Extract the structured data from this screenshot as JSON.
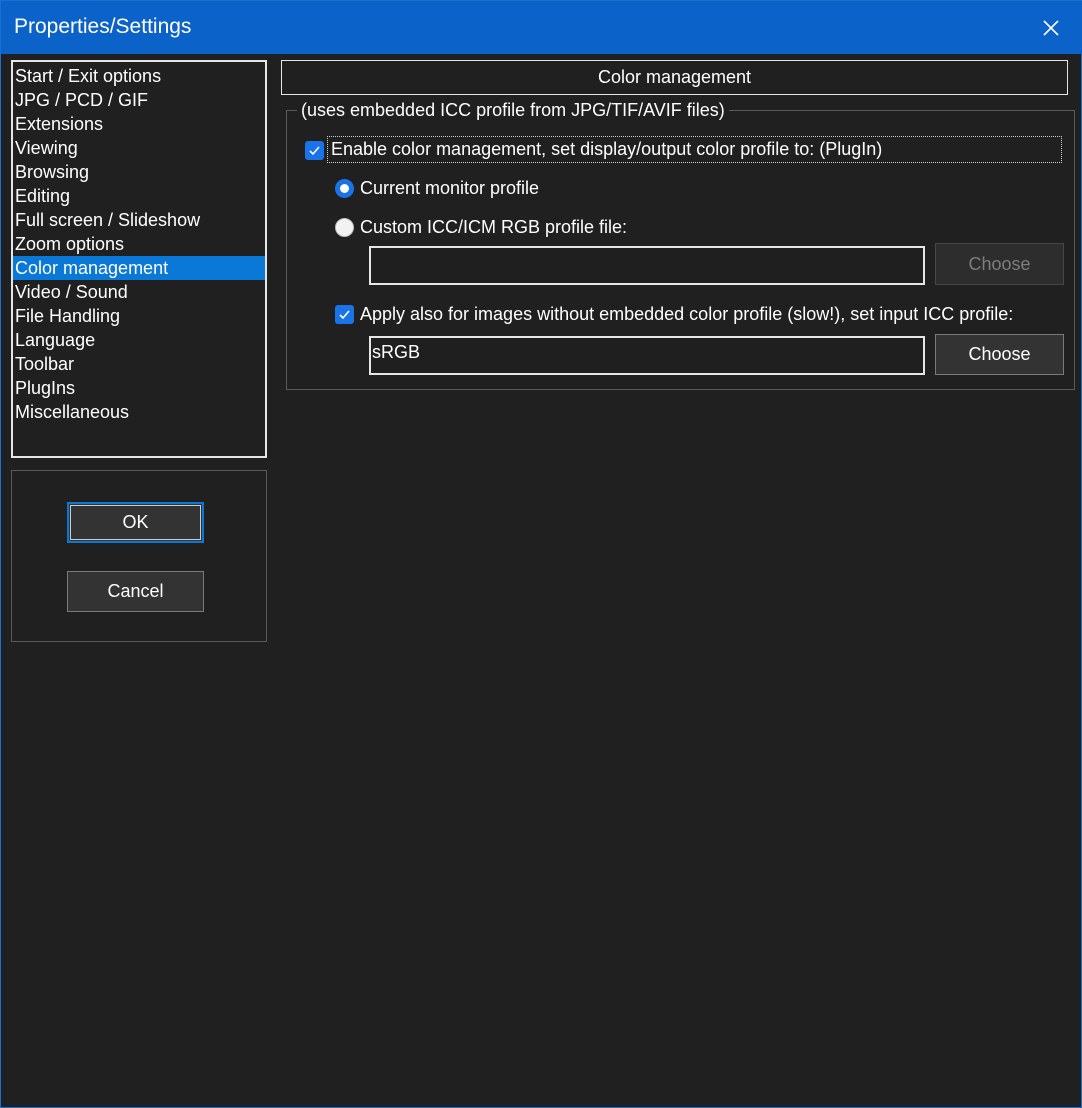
{
  "window": {
    "title": "Properties/Settings"
  },
  "sidebar": {
    "items": [
      {
        "label": "Start / Exit options"
      },
      {
        "label": "JPG / PCD / GIF"
      },
      {
        "label": "Extensions"
      },
      {
        "label": "Viewing"
      },
      {
        "label": "Browsing"
      },
      {
        "label": "Editing"
      },
      {
        "label": "Full screen / Slideshow"
      },
      {
        "label": "Zoom options"
      },
      {
        "label": "Color management",
        "selected": true
      },
      {
        "label": "Video / Sound"
      },
      {
        "label": "File Handling"
      },
      {
        "label": "Language"
      },
      {
        "label": "Toolbar"
      },
      {
        "label": "PlugIns"
      },
      {
        "label": "Miscellaneous"
      }
    ]
  },
  "buttons": {
    "ok": "OK",
    "cancel": "Cancel"
  },
  "panel": {
    "header": "Color management",
    "group_legend": "(uses embedded ICC profile from JPG/TIF/AVIF files)",
    "enable_cm": {
      "label": "Enable color management, set display/output color profile to: (PlugIn)",
      "checked": true
    },
    "radio_current": {
      "label": "Current monitor profile",
      "selected": true
    },
    "radio_custom": {
      "label": "Custom ICC/ICM RGB profile file:",
      "selected": false
    },
    "custom_profile_path": "",
    "choose_custom": "Choose",
    "apply_also": {
      "label": "Apply also for images without embedded color profile (slow!), set input ICC profile:",
      "checked": true
    },
    "input_profile": "sRGB",
    "choose_input": "Choose"
  },
  "colors": {
    "accent": "#0a78d7",
    "titlebar": "#0b63c9",
    "background": "#202020"
  }
}
